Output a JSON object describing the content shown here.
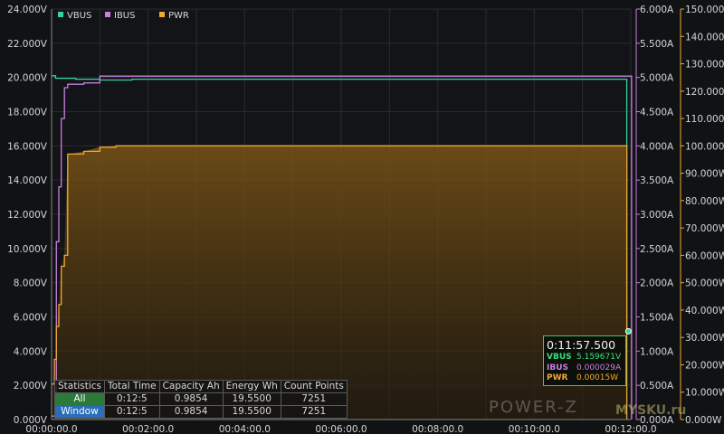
{
  "chart_data": {
    "type": "line",
    "x_axis": {
      "ticks": [
        "00:00:00.0",
        "00:02:00.0",
        "00:04:00.0",
        "00:06:00.0",
        "00:08:00.0",
        "00:10:00.0",
        "00:12:00.0"
      ],
      "range_seconds": [
        0,
        720
      ]
    },
    "y_left": {
      "unit": "V",
      "range": [
        0,
        24
      ],
      "ticks": [
        "0.000V",
        "2.000V",
        "4.000V",
        "6.000V",
        "8.000V",
        "10.000V",
        "12.000V",
        "14.000V",
        "16.000V",
        "18.000V",
        "20.000V",
        "22.000V",
        "24.000V"
      ]
    },
    "y_mid": {
      "unit": "A",
      "range": [
        0,
        6
      ],
      "ticks": [
        "0.000A",
        "0.500A",
        "1.000A",
        "1.500A",
        "2.000A",
        "2.500A",
        "3.000A",
        "3.500A",
        "4.000A",
        "4.500A",
        "5.000A",
        "5.500A",
        "6.000A"
      ]
    },
    "y_right": {
      "unit": "W",
      "range": [
        0,
        150
      ],
      "ticks": [
        "0.000W",
        "10.000W",
        "20.000W",
        "30.000W",
        "40.000W",
        "50.000W",
        "60.000W",
        "70.000W",
        "80.000W",
        "90.000W",
        "100.000W",
        "110.000W",
        "120.000W",
        "130.000W",
        "140.000W",
        "150.000W"
      ]
    },
    "series": [
      {
        "name": "VBUS",
        "axis": "left",
        "color": "#35d39a",
        "points": [
          [
            0,
            20.1
          ],
          [
            5,
            19.95
          ],
          [
            30,
            19.9
          ],
          [
            60,
            19.85
          ],
          [
            100,
            19.9
          ],
          [
            200,
            19.9
          ],
          [
            400,
            19.9
          ],
          [
            600,
            19.9
          ],
          [
            714,
            19.9
          ],
          [
            715,
            5.2
          ],
          [
            717,
            5.16
          ]
        ]
      },
      {
        "name": "IBUS",
        "axis": "mid",
        "color": "#c77fe0",
        "points": [
          [
            0,
            0.05
          ],
          [
            4,
            0.1
          ],
          [
            6,
            2.6
          ],
          [
            9,
            3.4
          ],
          [
            12,
            4.4
          ],
          [
            16,
            4.85
          ],
          [
            20,
            4.9
          ],
          [
            40,
            4.92
          ],
          [
            60,
            5.02
          ],
          [
            200,
            5.02
          ],
          [
            500,
            5.02
          ],
          [
            720,
            5.02
          ],
          [
            721,
            0.0
          ]
        ]
      },
      {
        "name": "PWR",
        "axis": "right",
        "color": "#f0a832",
        "points": [
          [
            0,
            13
          ],
          [
            3,
            13
          ],
          [
            3.5,
            22
          ],
          [
            5,
            22
          ],
          [
            6,
            34
          ],
          [
            9,
            42
          ],
          [
            12,
            56
          ],
          [
            16,
            60
          ],
          [
            20,
            97
          ],
          [
            22,
            97
          ],
          [
            40,
            98
          ],
          [
            60,
            99.5
          ],
          [
            80,
            100
          ],
          [
            300,
            100
          ],
          [
            500,
            100
          ],
          [
            650,
            100
          ],
          [
            714,
            100
          ],
          [
            715,
            0.001
          ]
        ]
      }
    ],
    "legend": {
      "position": "top-left",
      "entries": [
        "VBUS",
        "IBUS",
        "PWR"
      ]
    }
  },
  "tooltip": {
    "time": "0:11:57.500",
    "rows": [
      {
        "key": "VBUS",
        "value": "5.159671V",
        "color": "#35e07a"
      },
      {
        "key": "IBUS",
        "value": "0.000029A",
        "color": "#c77fe0"
      },
      {
        "key": "PWR",
        "value": "0.00015W",
        "color": "#f0a832"
      }
    ]
  },
  "stats": {
    "headers": [
      "Statistics",
      "Total Time",
      "Capacity Ah",
      "Energy Wh",
      "Count Points"
    ],
    "rows": [
      {
        "label": "All",
        "values": [
          "0:12:5",
          "0.9854",
          "19.5500",
          "7251"
        ]
      },
      {
        "label": "Window",
        "values": [
          "0:12:5",
          "0.9854",
          "19.5500",
          "7251"
        ]
      }
    ]
  },
  "watermark": {
    "text": "POWER-Z",
    "site": "MYSKU.ru"
  }
}
